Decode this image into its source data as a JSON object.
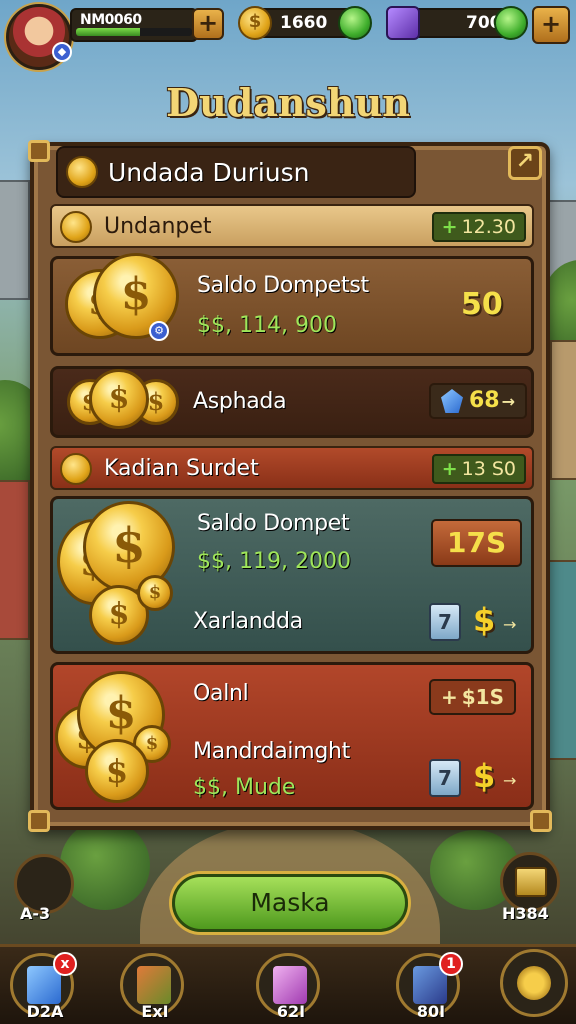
{
  "hud": {
    "player_name": "NM0060",
    "xp_fraction": 0.55,
    "coins": "1660",
    "gems": "700",
    "plus_symbol": "+"
  },
  "screen_title": "Dudanshun",
  "panel": {
    "header": "Undada Duriusn",
    "close_symbol": "↗",
    "section1": {
      "label": "Undanpet",
      "tag_plus": "+",
      "tag_value": "12.30"
    },
    "card1": {
      "label": "Saldo Dompetst",
      "money": "$$, 114, 900",
      "big_value": "50"
    },
    "card2": {
      "label": "Asphada",
      "value": "68",
      "arrow": "→"
    },
    "section2": {
      "label": "Kadian Surdet",
      "tag_plus": "+",
      "tag_value": "13 S0"
    },
    "card3": {
      "label": "Saldo Dompet",
      "money": "$$, 119, 2000",
      "big_value": "17S",
      "sublabel": "Xarlandda",
      "cube_symbol": "7",
      "dollar": "$",
      "arrow": "→"
    },
    "card4": {
      "label": "Oalnl",
      "label2": "Mandrdaimght",
      "money": "$$, Mude",
      "value": "$1S",
      "value_plus": "+",
      "cube_symbol": "7",
      "dollar": "$",
      "arrow": "→"
    }
  },
  "main_button": "Maska",
  "side_left_label": "A-3",
  "side_right_label": "H384",
  "nav": [
    {
      "label": "D2A",
      "badge": "x"
    },
    {
      "label": "ExI",
      "badge": ""
    },
    {
      "label": "62I",
      "badge": ""
    },
    {
      "label": "80I",
      "badge": "1"
    },
    {
      "label": "",
      "badge": ""
    }
  ]
}
